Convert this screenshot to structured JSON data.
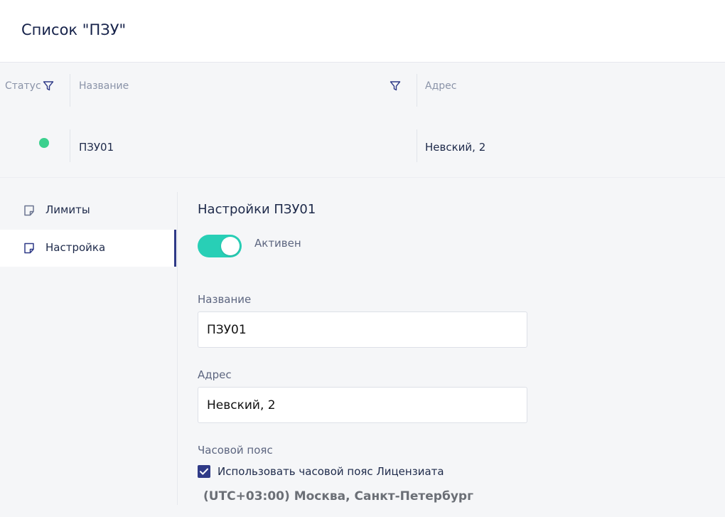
{
  "header": {
    "title": "Список \"ПЗУ\""
  },
  "table": {
    "columns": [
      {
        "label": "Статус"
      },
      {
        "label": "Название"
      },
      {
        "label": "Адрес"
      }
    ],
    "rows": [
      {
        "status": "active",
        "name": "ПЗУ01",
        "address": "Невский, 2"
      }
    ]
  },
  "sidebar": {
    "items": [
      {
        "label": "Лимиты",
        "icon": "document-icon"
      },
      {
        "label": "Настройка",
        "icon": "document-icon"
      }
    ]
  },
  "settings": {
    "title": "Настройки ПЗУ01",
    "toggle_label": "Активен",
    "name_label": "Название",
    "name_value": "ПЗУ01",
    "address_label": "Адрес",
    "address_value": "Невский, 2",
    "timezone_label": "Часовой пояс",
    "use_licensee_tz_label": "Использовать часовой пояс Лицензиата",
    "timezone_value": "(UTC+03:00) Москва, Санкт-Петербург"
  },
  "colors": {
    "accent": "#2f3a87",
    "toggle_on": "#28cfb6",
    "status_active": "#3bd08e"
  }
}
